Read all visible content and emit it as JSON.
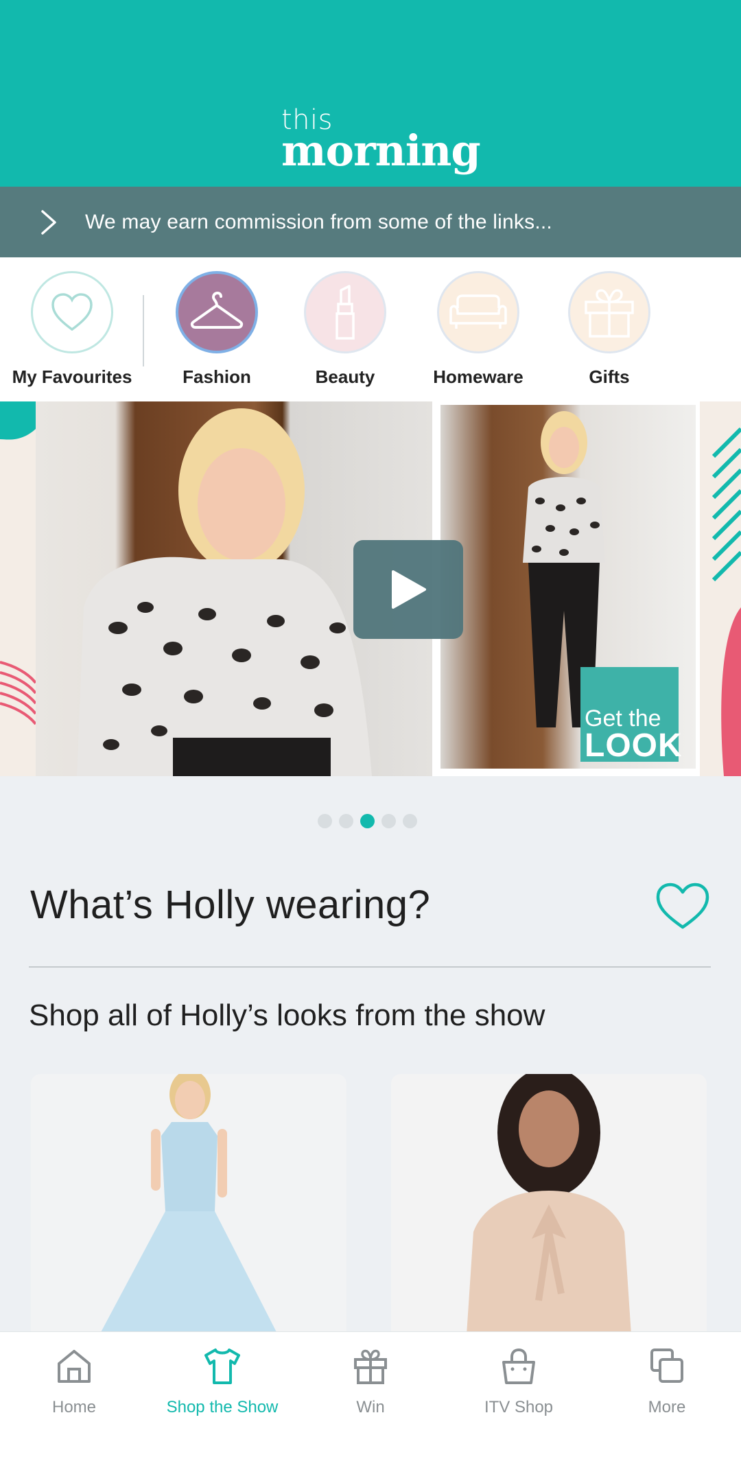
{
  "header": {
    "logo_line1": "this",
    "logo_line2": "morning",
    "brand_color": "#12b9ad"
  },
  "commission_banner": {
    "text": "We may earn commission from some of the links...",
    "icon": "chevron-right-icon"
  },
  "categories": [
    {
      "label": "My Favourites",
      "icon": "heart-icon"
    },
    {
      "label": "Fashion",
      "icon": "hanger-icon",
      "selected": true
    },
    {
      "label": "Beauty",
      "icon": "lipstick-icon"
    },
    {
      "label": "Homeware",
      "icon": "sofa-icon"
    },
    {
      "label": "Gifts",
      "icon": "gift-icon"
    }
  ],
  "hero": {
    "badge_line1": "Get the",
    "badge_line2": "LOOK",
    "play_icon": "play-icon"
  },
  "carousel": {
    "total": 5,
    "active_index": 2
  },
  "section": {
    "title": "What’s Holly wearing?",
    "subtitle": "Shop all of Holly’s looks from the show"
  },
  "tabs": [
    {
      "label": "Home",
      "icon": "home-icon"
    },
    {
      "label": "Shop the Show",
      "icon": "tshirt-icon",
      "active": true
    },
    {
      "label": "Win",
      "icon": "gift-icon"
    },
    {
      "label": "ITV Shop",
      "icon": "shopping-bag-icon"
    },
    {
      "label": "More",
      "icon": "copy-icon"
    }
  ],
  "colors": {
    "accent": "#12b9ad",
    "banner": "#567b7e",
    "fashion_circle": "#a77a9c"
  }
}
